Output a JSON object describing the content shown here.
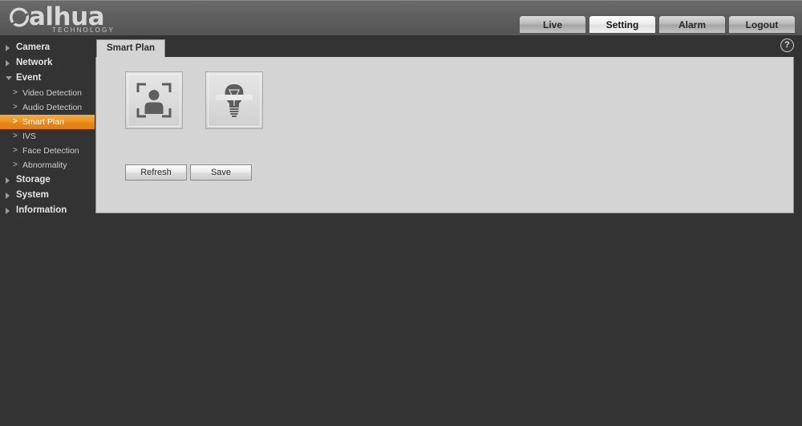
{
  "header": {
    "logo_text": "alhua",
    "logo_sub": "TECHNOLOGY",
    "nav_tabs": [
      {
        "label": "Live",
        "active": false
      },
      {
        "label": "Setting",
        "active": true
      },
      {
        "label": "Alarm",
        "active": false
      },
      {
        "label": "Logout",
        "active": false
      }
    ]
  },
  "sidebar": {
    "groups": [
      {
        "label": "Camera",
        "expanded": false
      },
      {
        "label": "Network",
        "expanded": false
      },
      {
        "label": "Event",
        "expanded": true
      },
      {
        "label": "Storage",
        "expanded": false
      },
      {
        "label": "System",
        "expanded": false
      },
      {
        "label": "Information",
        "expanded": false
      }
    ],
    "event_items": [
      {
        "label": "Video Detection",
        "active": false
      },
      {
        "label": "Audio Detection",
        "active": false
      },
      {
        "label": "Smart Plan",
        "active": true
      },
      {
        "label": "IVS",
        "active": false
      },
      {
        "label": "Face Detection",
        "active": false
      },
      {
        "label": "Abnormality",
        "active": false
      }
    ],
    "chevron": ">"
  },
  "tabbar": {
    "active_tab": "Smart Plan",
    "help_label": "?"
  },
  "main": {
    "cards": [
      {
        "name": "face-detection-card",
        "icon": "face-detection-icon",
        "selected": false
      },
      {
        "name": "smart-plan-bulb-card",
        "icon": "light-bulb-icon",
        "selected": false
      }
    ],
    "buttons": [
      {
        "label": "Refresh",
        "name": "refresh-button"
      },
      {
        "label": "Save",
        "name": "save-button"
      }
    ]
  },
  "colors": {
    "accent": "#ef9722",
    "background_dark": "#333333",
    "panel": "#d4d4d4",
    "header": "#606060"
  }
}
